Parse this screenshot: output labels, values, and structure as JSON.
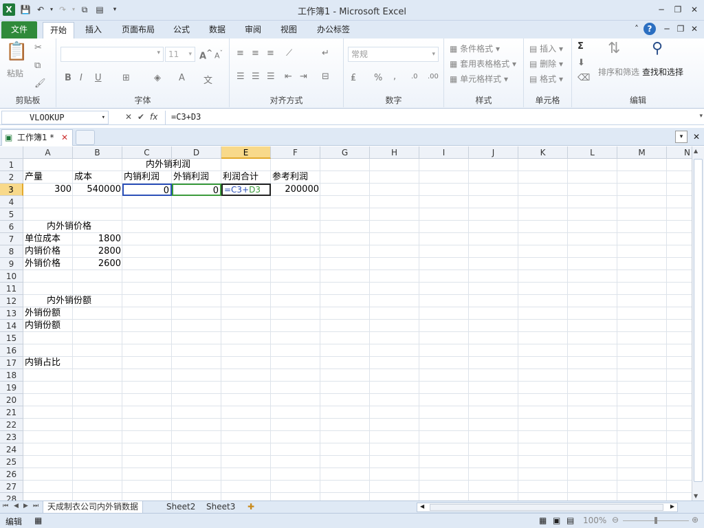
{
  "window": {
    "title": "工作簿1 - Microsoft Excel"
  },
  "quick_access": [
    "save-icon",
    "undo-icon",
    "redo-icon",
    "copy-icon",
    "paste-icon",
    "customize-icon"
  ],
  "tabs": [
    "文件",
    "开始",
    "插入",
    "页面布局",
    "公式",
    "数据",
    "审阅",
    "视图",
    "办公标签"
  ],
  "ribbon": {
    "clipboard": {
      "label": "剪贴板",
      "paste": "粘贴"
    },
    "font": {
      "label": "字体",
      "size": "11",
      "bold": "B",
      "italic": "I",
      "underline": "U"
    },
    "alignment": {
      "label": "对齐方式"
    },
    "number": {
      "label": "数字",
      "format": "常规",
      "percent": "%",
      "comma": ","
    },
    "styles": {
      "label": "样式",
      "cond": "条件格式",
      "table": "套用表格格式",
      "cell": "单元格样式"
    },
    "cells": {
      "label": "单元格",
      "insert": "插入",
      "delete": "删除",
      "format": "格式"
    },
    "editing": {
      "label": "编辑",
      "sum": "Σ",
      "sort": "排序和筛选",
      "find": "查找和选择"
    }
  },
  "formula_bar": {
    "name_box": "VLOOKUP",
    "fx": "fx",
    "formula": "=C3+D3"
  },
  "workbook_tab": {
    "name": "工作簿1 *"
  },
  "columns": [
    "A",
    "B",
    "C",
    "D",
    "E",
    "F",
    "G",
    "H",
    "I",
    "J",
    "K",
    "L",
    "M",
    "N"
  ],
  "rows": [
    "1",
    "2",
    "3",
    "4",
    "5",
    "6",
    "7",
    "8",
    "9",
    "10",
    "11",
    "12",
    "13",
    "14",
    "15",
    "16",
    "17",
    "18",
    "19",
    "20",
    "21",
    "22",
    "23",
    "24",
    "25",
    "26",
    "27",
    "28"
  ],
  "cells": {
    "C1": "内外销利润",
    "A2": "产量",
    "B2": "成本",
    "C2": "内销利润",
    "D2": "外销利润",
    "E2": "利润合计",
    "F2": "参考利润",
    "A3": "300",
    "B3": "540000",
    "C3": "0",
    "D3": "0",
    "E3a": "=C3+",
    "E3b": "D3",
    "F3": "200000",
    "A6": "内外销价格",
    "A7": "单位成本",
    "B7": "1800",
    "A8": "内销价格",
    "B8": "2800",
    "A9": "外销价格",
    "B9": "2600",
    "A12": "内外销份额",
    "A13": "外销份额",
    "A14": "内销份额",
    "A17": "内销占比"
  },
  "sheets": [
    "天成制衣公司内外销数据",
    "Sheet2",
    "Sheet3"
  ],
  "status": {
    "mode": "编辑",
    "zoom": "100%"
  }
}
